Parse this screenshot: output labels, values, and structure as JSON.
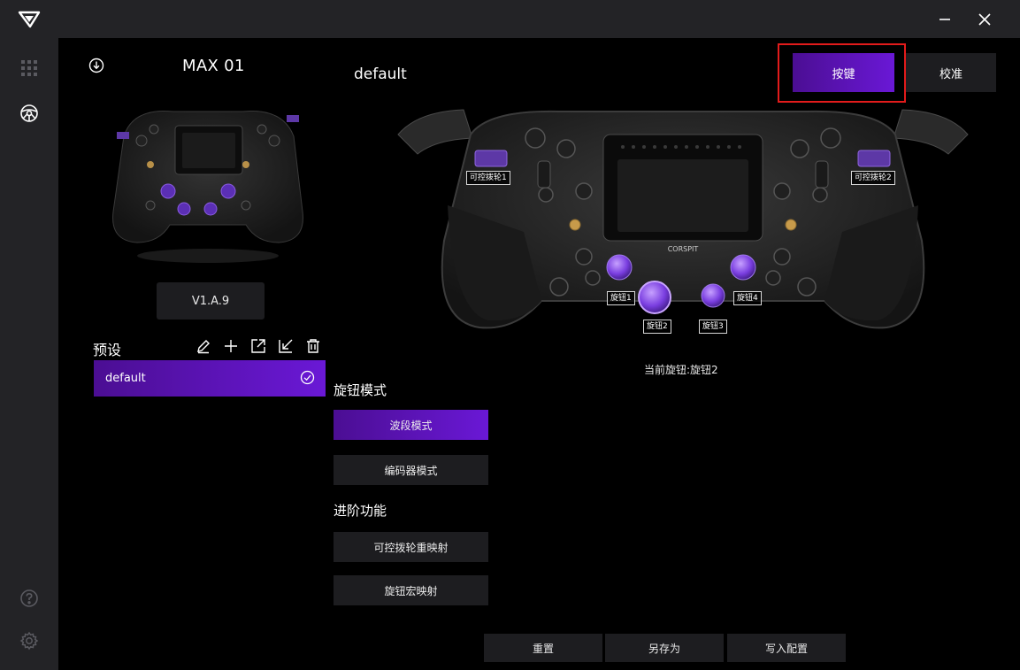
{
  "window": {
    "minimize_label": "—",
    "close_label": "✕"
  },
  "sidebar": {
    "items": [
      {
        "icon": "grid-icon"
      },
      {
        "icon": "steering-wheel-icon"
      },
      {
        "icon": "help-icon"
      },
      {
        "icon": "gear-icon"
      }
    ]
  },
  "device": {
    "model": "MAX 01",
    "firmware_version": "V1.A.9"
  },
  "presets": {
    "label": "预设",
    "items": [
      {
        "name": "default",
        "selected": true
      }
    ]
  },
  "profile": {
    "name": "default"
  },
  "tabs": [
    {
      "label": "按键",
      "active": true
    },
    {
      "label": "校准",
      "active": false
    }
  ],
  "knob_mode": {
    "title": "旋钮模式",
    "options": [
      {
        "label": "波段模式",
        "active": true
      },
      {
        "label": "编码器模式",
        "active": false
      }
    ]
  },
  "advanced": {
    "title": "进阶功能",
    "options": [
      {
        "label": "可控拨轮重映射"
      },
      {
        "label": "旋钮宏映射"
      }
    ]
  },
  "wheel_tags": {
    "paddle1": "可控拨轮1",
    "paddle2": "可控拨轮2",
    "knob1": "旋钮1",
    "knob2": "旋钮2",
    "knob3": "旋钮3",
    "knob4": "旋钮4"
  },
  "current_knob": "当前旋钮:旋钮2",
  "wheel_brand": "CORSPIT",
  "footer": {
    "reset": "重置",
    "save_as": "另存为",
    "write_config": "写入配置"
  },
  "colors": {
    "accent_start": "#4b0e93",
    "accent_end": "#6a18d6",
    "highlight": "#e21b1b",
    "panel": "#232326"
  }
}
